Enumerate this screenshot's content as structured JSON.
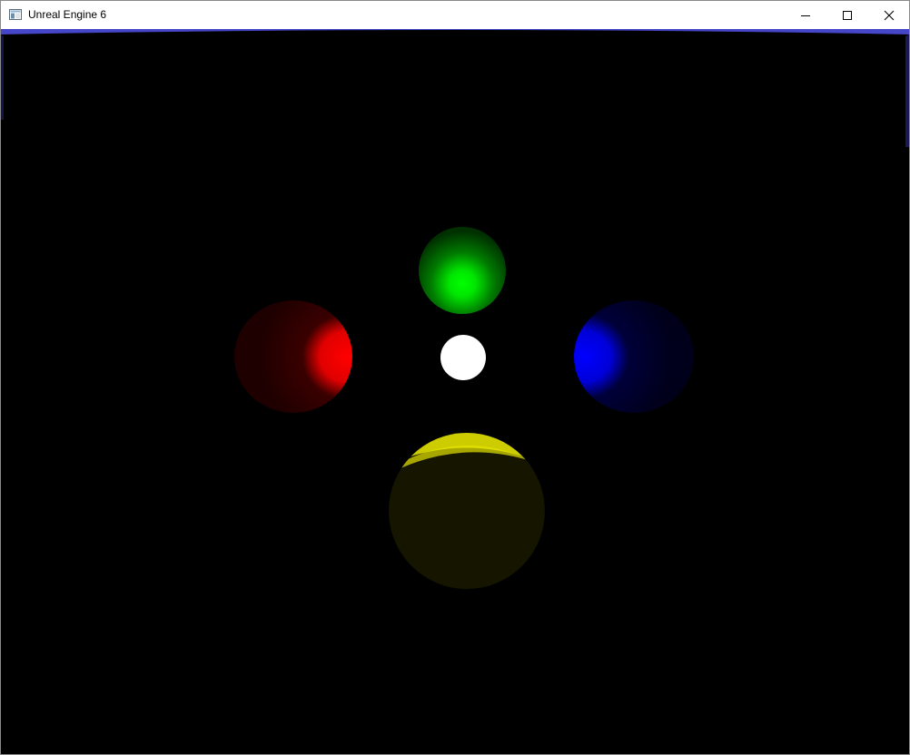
{
  "window": {
    "title": "Unreal Engine 6"
  },
  "icons": {
    "app": "app-window-icon",
    "minimize": "minimize-icon",
    "maximize": "maximize-icon",
    "close": "close-icon"
  },
  "scene": {
    "background": "#000000",
    "horizon_color": "#4646c8",
    "objects": [
      {
        "name": "green-sphere",
        "color": "#00ff00"
      },
      {
        "name": "red-sphere",
        "color": "#ff0000"
      },
      {
        "name": "white-sphere",
        "color": "#ffffff"
      },
      {
        "name": "blue-sphere",
        "color": "#0000ff"
      },
      {
        "name": "yellow-sphere",
        "color": "#ffff00"
      }
    ]
  }
}
